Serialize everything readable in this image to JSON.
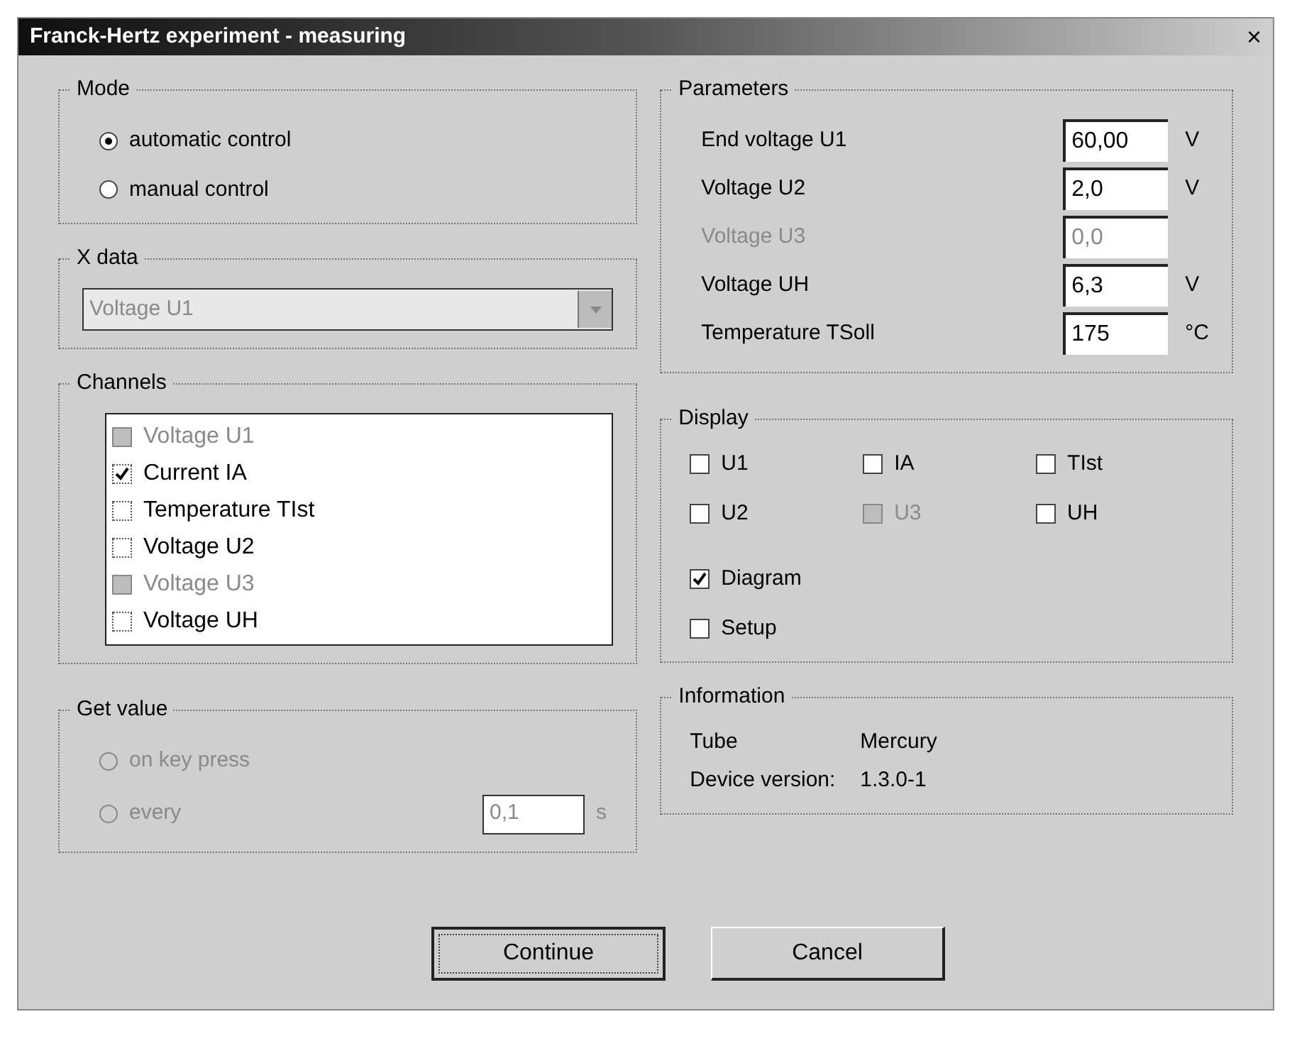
{
  "window": {
    "title": "Franck-Hertz experiment - measuring",
    "close": "×"
  },
  "mode": {
    "title": "Mode",
    "options": [
      {
        "label": "automatic control",
        "selected": true
      },
      {
        "label": "manual control",
        "selected": false
      }
    ]
  },
  "x_data": {
    "title": "X data",
    "value": "Voltage U1",
    "disabled": true
  },
  "channels": {
    "title": "Channels",
    "items": [
      {
        "label": "Voltage U1",
        "checked": false,
        "disabled": true
      },
      {
        "label": "Current IA",
        "checked": true,
        "disabled": false
      },
      {
        "label": "Temperature TIst",
        "checked": false,
        "disabled": false
      },
      {
        "label": "Voltage U2",
        "checked": false,
        "disabled": false
      },
      {
        "label": "Voltage U3",
        "checked": false,
        "disabled": true
      },
      {
        "label": "Voltage UH",
        "checked": false,
        "disabled": false
      }
    ]
  },
  "get_value": {
    "title": "Get value",
    "disabled": true,
    "options": [
      {
        "label": "on key press",
        "selected": false
      },
      {
        "label": "every",
        "selected": false
      }
    ],
    "interval": "0,1",
    "unit": "s"
  },
  "parameters": {
    "title": "Parameters",
    "rows": [
      {
        "label": "End voltage U1",
        "value": "60,00",
        "unit": "V",
        "disabled": false
      },
      {
        "label": "Voltage U2",
        "value": "2,0",
        "unit": "V",
        "disabled": false
      },
      {
        "label": "Voltage U3",
        "value": "0,0",
        "disabled": true
      },
      {
        "label": "Voltage UH",
        "value": "6,3",
        "unit": "V",
        "disabled": false
      },
      {
        "label": "Temperature TSoll",
        "value": "175",
        "unit": "°C",
        "disabled": false
      }
    ]
  },
  "display": {
    "title": "Display",
    "grid": [
      {
        "label": "U1",
        "checked": false,
        "disabled": false
      },
      {
        "label": "IA",
        "checked": false,
        "disabled": false
      },
      {
        "label": "TIst",
        "checked": false,
        "disabled": false
      },
      {
        "label": "U2",
        "checked": false,
        "disabled": false
      },
      {
        "label": "U3",
        "checked": false,
        "disabled": true
      },
      {
        "label": "UH",
        "checked": false,
        "disabled": false
      }
    ],
    "options": [
      {
        "label": "Diagram",
        "checked": true,
        "disabled": false
      },
      {
        "label": "Setup",
        "checked": false,
        "disabled": false
      }
    ]
  },
  "information": {
    "title": "Information",
    "rows": [
      {
        "label": "Tube",
        "value": "Mercury"
      },
      {
        "label": "Device version:",
        "value": "1.3.0-1"
      }
    ]
  },
  "buttons": [
    {
      "label": "Continue",
      "default": true
    },
    {
      "label": "Cancel",
      "default": false
    }
  ]
}
